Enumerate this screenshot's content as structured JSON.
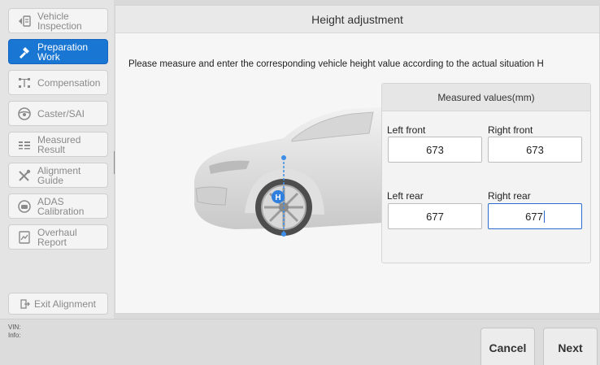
{
  "sidebar": {
    "items": [
      {
        "label": "Vehicle Inspection",
        "icon": "inspection-icon",
        "active": false
      },
      {
        "label": "Preparation Work",
        "icon": "preparation-icon",
        "active": true
      },
      {
        "label": "Compensation",
        "icon": "compensation-icon",
        "active": false
      },
      {
        "label": "Caster/SAI",
        "icon": "steering-wheel-icon",
        "active": false
      },
      {
        "label": "Measured Result",
        "icon": "result-list-icon",
        "active": false
      },
      {
        "label": "Alignment Guide",
        "icon": "tools-icon",
        "active": false
      },
      {
        "label": "ADAS Calibration",
        "icon": "adas-icon",
        "active": false
      },
      {
        "label": "Overhaul Report",
        "icon": "report-icon",
        "active": false
      }
    ],
    "exit_label": "Exit Alignment"
  },
  "main": {
    "title": "Height adjustment",
    "instruction": "Please measure and enter the corresponding vehicle height value according to the actual situation H"
  },
  "measured": {
    "title": "Measured values(mm)",
    "left_front": {
      "label": "Left front",
      "value": "673"
    },
    "right_front": {
      "label": "Right front",
      "value": "673"
    },
    "left_rear": {
      "label": "Left rear",
      "value": "677"
    },
    "right_rear": {
      "label": "Right rear",
      "value": "677"
    }
  },
  "footer": {
    "vin_label": "VIN:",
    "info_label": "Info:",
    "cancel_label": "Cancel",
    "next_label": "Next"
  },
  "colors": {
    "accent": "#1976d2",
    "focus": "#2b6cd1"
  }
}
